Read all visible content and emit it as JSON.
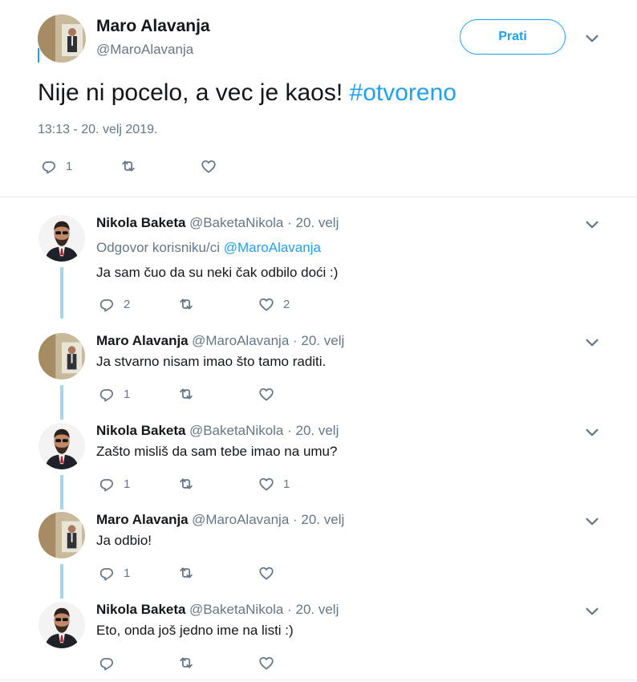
{
  "main_tweet": {
    "author_name": "Maro Alavanja",
    "author_handle": "@MaroAlavanja",
    "follow_label": "Prati",
    "text": "Nije ni pocelo, a vec je kaos!",
    "hashtag": "#otvoreno",
    "timestamp": "13:13 - 20. velj 2019.",
    "reply_count": "1"
  },
  "replies": [
    {
      "name": "Nikola Baketa",
      "meta": "@BaketaNikola · 20. velj",
      "replying_prefix": "Odgovor korisniku/ci",
      "replying_to": "@MaroAlavanja",
      "text": "Ja sam čuo da su neki čak odbilo doći :)",
      "reply_count": "2",
      "like_count": "2"
    },
    {
      "name": "Maro Alavanja",
      "meta": "@MaroAlavanja · 20. velj",
      "text": "Ja stvarno nisam imao što tamo raditi.",
      "reply_count": "1",
      "like_count": ""
    },
    {
      "name": "Nikola Baketa",
      "meta": "@BaketaNikola · 20. velj",
      "text": "Zašto misliš da sam tebe imao na umu?",
      "reply_count": "1",
      "like_count": "1"
    },
    {
      "name": "Maro Alavanja",
      "meta": "@MaroAlavanja · 20. velj",
      "text": "Ja odbio!",
      "reply_count": "1",
      "like_count": ""
    },
    {
      "name": "Nikola Baketa",
      "meta": "@BaketaNikola · 20. velj",
      "text": "Eto, onda još jedno ime na listi :)",
      "reply_count": "",
      "like_count": ""
    }
  ],
  "icons": {
    "reply": "reply-icon",
    "retweet": "retweet-icon",
    "like": "heart-icon",
    "more": "chevron-down-icon"
  },
  "colors": {
    "accent": "#1da1f2",
    "muted": "#657786",
    "thread_line": "#a6d7e8",
    "text": "#14171a"
  }
}
